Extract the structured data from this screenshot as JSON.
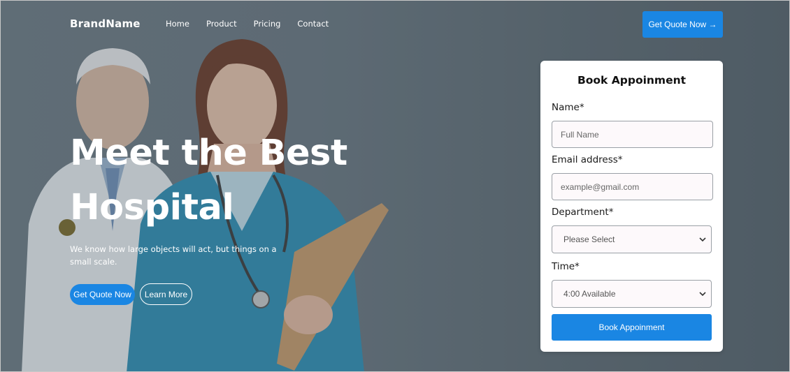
{
  "colors": {
    "accent": "#1a86e3",
    "background": "#6a7780",
    "card": "#ffffff"
  },
  "nav": {
    "brand": "BrandName",
    "links": [
      "Home",
      "Product",
      "Pricing",
      "Contact"
    ],
    "cta": "Get Quote Now →"
  },
  "hero": {
    "title_line1": "Meet the Best",
    "title_line2": "Hospital",
    "subtitle": "We know how large objects will act, but things on a small scale.",
    "primary_button": "Get Quote Now",
    "secondary_button": "Learn More"
  },
  "form": {
    "title": "Book Appoinment",
    "name_label": "Name*",
    "name_placeholder": "Full Name",
    "email_label": "Email address*",
    "email_placeholder": "example@gmail.com",
    "department_label": "Department*",
    "department_value": "Please Select",
    "time_label": "Time*",
    "time_value": "4:00 Available",
    "submit": "Book Appoinment"
  },
  "icons": [
    "arrow-right-icon",
    "chevron-down-icon"
  ]
}
